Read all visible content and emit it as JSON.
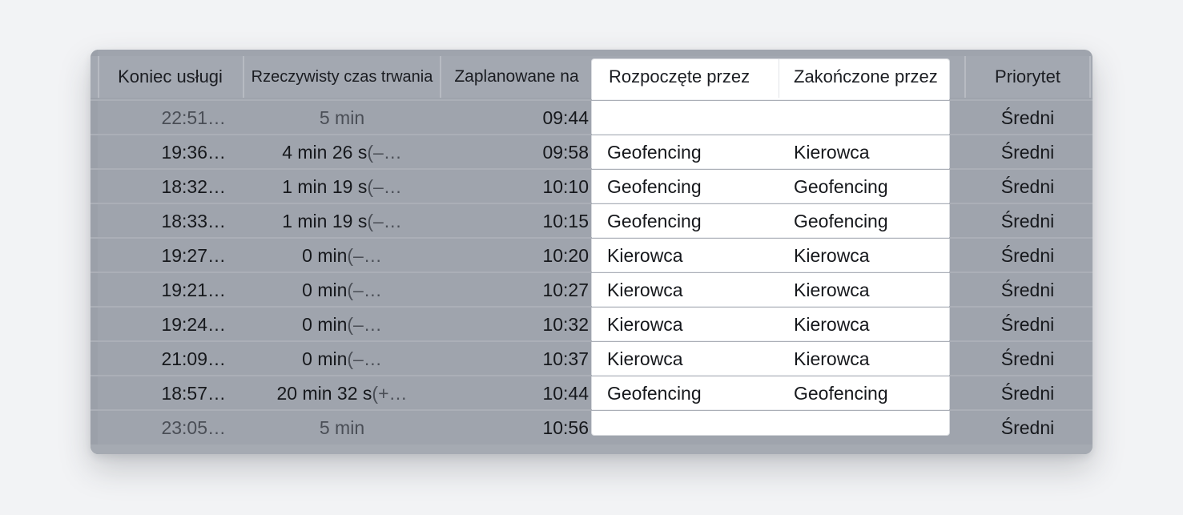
{
  "table": {
    "columns": {
      "end": "Koniec usługi",
      "duration": "Rzeczywisty czas trwania",
      "scheduled": "Zaplanowane na",
      "started_by": "Rozpoczęte przez",
      "ended_by": "Zakończone przez",
      "priority": "Priorytet"
    },
    "rows": [
      {
        "end": "22:51…",
        "dur_main": "5 min",
        "dur_paren": "",
        "scheduled": "09:44",
        "started_by": "",
        "ended_by": "",
        "priority": "Średni",
        "muted": true
      },
      {
        "end": "19:36…",
        "dur_main": "4 min 26 s",
        "dur_paren": " (–…",
        "scheduled": "09:58",
        "started_by": "Geofencing",
        "ended_by": "Kierowca",
        "priority": "Średni",
        "muted": false
      },
      {
        "end": "18:32…",
        "dur_main": "1 min 19 s",
        "dur_paren": " (–…",
        "scheduled": "10:10",
        "started_by": "Geofencing",
        "ended_by": "Geofencing",
        "priority": "Średni",
        "muted": false
      },
      {
        "end": "18:33…",
        "dur_main": "1 min 19 s",
        "dur_paren": " (–…",
        "scheduled": "10:15",
        "started_by": "Geofencing",
        "ended_by": "Geofencing",
        "priority": "Średni",
        "muted": false
      },
      {
        "end": "19:27…",
        "dur_main": "0 min",
        "dur_paren": " (–…",
        "scheduled": "10:20",
        "started_by": "Kierowca",
        "ended_by": "Kierowca",
        "priority": "Średni",
        "muted": false
      },
      {
        "end": "19:21…",
        "dur_main": "0 min",
        "dur_paren": " (–…",
        "scheduled": "10:27",
        "started_by": "Kierowca",
        "ended_by": "Kierowca",
        "priority": "Średni",
        "muted": false
      },
      {
        "end": "19:24…",
        "dur_main": "0 min",
        "dur_paren": " (–…",
        "scheduled": "10:32",
        "started_by": "Kierowca",
        "ended_by": "Kierowca",
        "priority": "Średni",
        "muted": false
      },
      {
        "end": "21:09…",
        "dur_main": "0 min",
        "dur_paren": " (–…",
        "scheduled": "10:37",
        "started_by": "Kierowca",
        "ended_by": "Kierowca",
        "priority": "Średni",
        "muted": false
      },
      {
        "end": "18:57…",
        "dur_main": "20 min 32 s",
        "dur_paren": " (+…",
        "scheduled": "10:44",
        "started_by": "Geofencing",
        "ended_by": "Geofencing",
        "priority": "Średni",
        "muted": false
      },
      {
        "end": "23:05…",
        "dur_main": "5 min",
        "dur_paren": "",
        "scheduled": "10:56",
        "started_by": "",
        "ended_by": "",
        "priority": "Średni",
        "muted": true
      }
    ]
  }
}
